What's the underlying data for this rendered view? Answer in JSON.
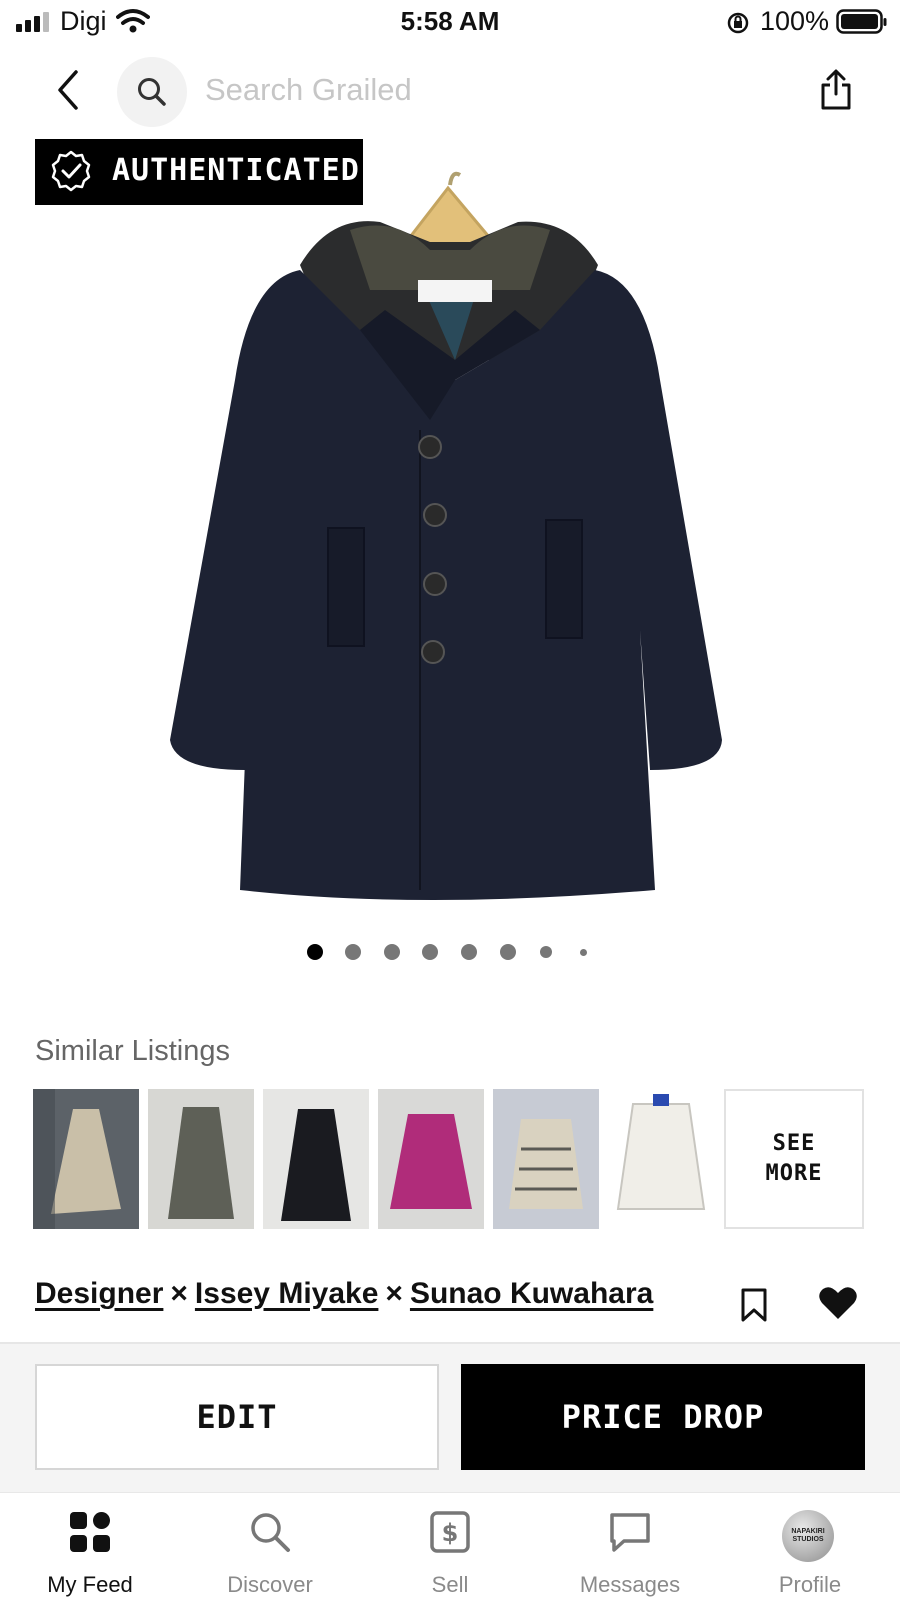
{
  "status_bar": {
    "carrier": "Digi",
    "time": "5:58 AM",
    "battery_percent": "100%"
  },
  "header": {
    "search_placeholder": "Search Grailed",
    "icons": [
      "back-icon",
      "search-icon",
      "share-icon"
    ]
  },
  "product": {
    "badge": "AUTHENTICATED",
    "image_count": 8,
    "active_image_index": 0
  },
  "similar": {
    "title": "Similar Listings",
    "see_more_line1": "SEE",
    "see_more_line2": "MORE",
    "thumbnail_colors": [
      "#c9bfa8",
      "#5e6057",
      "#1a1b20",
      "#b02c7a",
      "#d9d2c0",
      "#f0eee8"
    ]
  },
  "designers": {
    "items": [
      "Designer",
      "Issey Miyake",
      "Sunao Kuwahara"
    ],
    "separator": "×"
  },
  "actions": {
    "edit_label": "EDIT",
    "price_drop_label": "PRICE DROP"
  },
  "tabs": [
    {
      "label": "My Feed",
      "icon": "grid-icon",
      "active": true
    },
    {
      "label": "Discover",
      "icon": "search-icon",
      "active": false
    },
    {
      "label": "Sell",
      "icon": "dollar-icon",
      "active": false
    },
    {
      "label": "Messages",
      "icon": "chat-bubble-icon",
      "active": false
    },
    {
      "label": "Profile",
      "icon": "avatar-icon",
      "active": false
    }
  ],
  "profile_avatar_text": "NAPAKIRI STUDIOS",
  "colors": {
    "accent": "#000000",
    "coat": "#1d2233",
    "muted_text": "#8a8a8a"
  }
}
